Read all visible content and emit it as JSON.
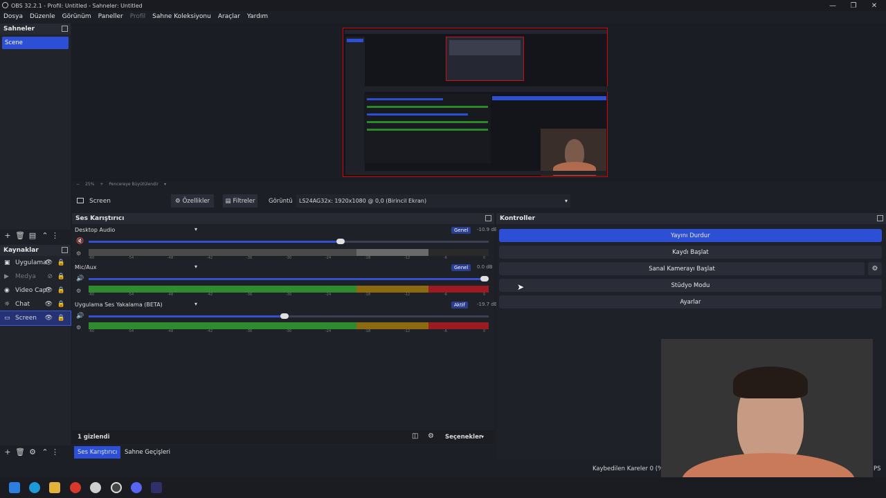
{
  "window": {
    "title": "OBS 32.2.1 - Profil: Untitled - Sahneler: Untitled"
  },
  "menu": [
    {
      "label": "Dosya",
      "dim": false
    },
    {
      "label": "Düzenle",
      "dim": false
    },
    {
      "label": "Görünüm",
      "dim": false
    },
    {
      "label": "Paneller",
      "dim": false
    },
    {
      "label": "Profil",
      "dim": true
    },
    {
      "label": "Sahne Koleksiyonu",
      "dim": false
    },
    {
      "label": "Araçlar",
      "dim": false
    },
    {
      "label": "Yardım",
      "dim": false
    }
  ],
  "scenes": {
    "title": "Sahneler",
    "items": [
      "Scene"
    ]
  },
  "sources": {
    "title": "Kaynaklar",
    "items": [
      {
        "label": "Uygulama",
        "icon": "window-icon",
        "visible": true
      },
      {
        "label": "Medya",
        "icon": "play-icon",
        "visible": false
      },
      {
        "label": "Video Cap",
        "icon": "camera-icon",
        "visible": true
      },
      {
        "label": "Chat",
        "icon": "globe-icon",
        "visible": true
      },
      {
        "label": "Screen",
        "icon": "monitor-icon",
        "visible": true,
        "selected": true
      }
    ]
  },
  "preview": {
    "zoom": "25%",
    "fit_label": "Pencereye Büyütülendir"
  },
  "source_toolbar": {
    "source_name": "Screen",
    "properties_label": "Özellikler",
    "filters_label": "Filtreler",
    "display_label": "Görüntü",
    "display_value": "LS24AG32x: 1920x1080 @ 0,0 (Birincil Ekran)"
  },
  "mixer": {
    "title": "Ses Karıştırıcı",
    "channels": [
      {
        "name": "Desktop Audio",
        "tag": "Genel",
        "db": "-10.9 dB",
        "level": 0.63,
        "muted": true
      },
      {
        "name": "Mic/Aux",
        "tag": "Genel",
        "db": "0.0 dB",
        "level": 1.0,
        "muted": false
      },
      {
        "name": "Uygulama Ses Yakalama (BETA)",
        "tag": "Aktif",
        "db": "-19.7 dB",
        "level": 0.49,
        "muted": false
      }
    ],
    "ticks": [
      "-60",
      "-54",
      "-48",
      "-42",
      "-36",
      "-30",
      "-24",
      "-18",
      "-12",
      "-6",
      "0"
    ],
    "hidden_label": "1 gizlendi",
    "options_label": "Seçenekler"
  },
  "controls": {
    "title": "Kontroller",
    "stop_stream": "Yayını Durdur",
    "start_record": "Kaydı Başlat",
    "virtual_cam": "Sanal Kamerayı Başlat",
    "studio_mode": "Stüdyo Modu",
    "settings": "Ayarlar"
  },
  "bottom_tabs": {
    "mixer": "Ses Karıştırıcı",
    "transitions": "Sahne Geçişleri"
  },
  "status": {
    "dropped": "Kaybedilen Kareler 0 (%0"
  },
  "colors": {
    "accent": "#2d4fd6",
    "selection": "#e00000"
  }
}
